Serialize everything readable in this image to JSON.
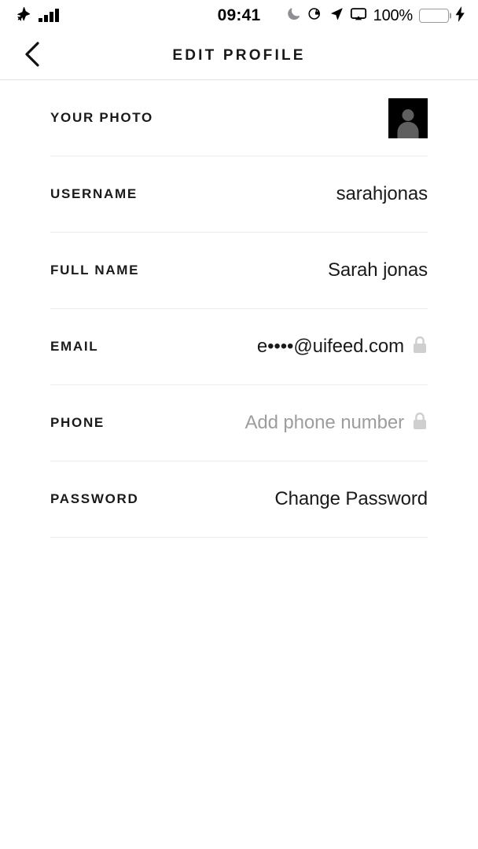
{
  "status_bar": {
    "airplane_icon": "airplane-icon",
    "signal_icon": "signal-bars-icon",
    "signal_bars_total": 4,
    "signal_bars_filled": 4,
    "time": "09:41",
    "dnd_icon": "moon-icon",
    "rotation_lock_icon": "rotation-lock-icon",
    "location_icon": "location-arrow-icon",
    "airplay_icon": "airplay-icon",
    "battery_percent": "100%",
    "battery_icon": "battery-icon",
    "battery_color": "#4cd964",
    "charging_icon": "lightning-bolt-icon"
  },
  "header": {
    "back_icon": "chevron-left-icon",
    "title": "EDIT PROFILE"
  },
  "form": {
    "rows": [
      {
        "label": "YOUR PHOTO",
        "value": "",
        "type": "avatar",
        "avatar_icon": "person-placeholder-icon",
        "avatar_bg": "#000000",
        "locked": false
      },
      {
        "label": "USERNAME",
        "value": "sarahjonas",
        "type": "text",
        "locked": false
      },
      {
        "label": "FULL NAME",
        "value": "Sarah jonas",
        "type": "text",
        "locked": false
      },
      {
        "label": "EMAIL",
        "value": "e••••@uifeed.com",
        "type": "text",
        "locked": true,
        "lock_icon": "lock-icon"
      },
      {
        "label": "PHONE",
        "value": "Add phone number",
        "type": "placeholder",
        "locked": true,
        "lock_icon": "lock-icon"
      },
      {
        "label": "PASSWORD",
        "value": "Change Password",
        "type": "text",
        "locked": false
      }
    ]
  },
  "colors": {
    "background": "#ffffff",
    "text_primary": "#1a1a1a",
    "text_placeholder": "#9d9d9d",
    "divider": "#ebebeb",
    "lock_gray": "#cfcfcf"
  }
}
